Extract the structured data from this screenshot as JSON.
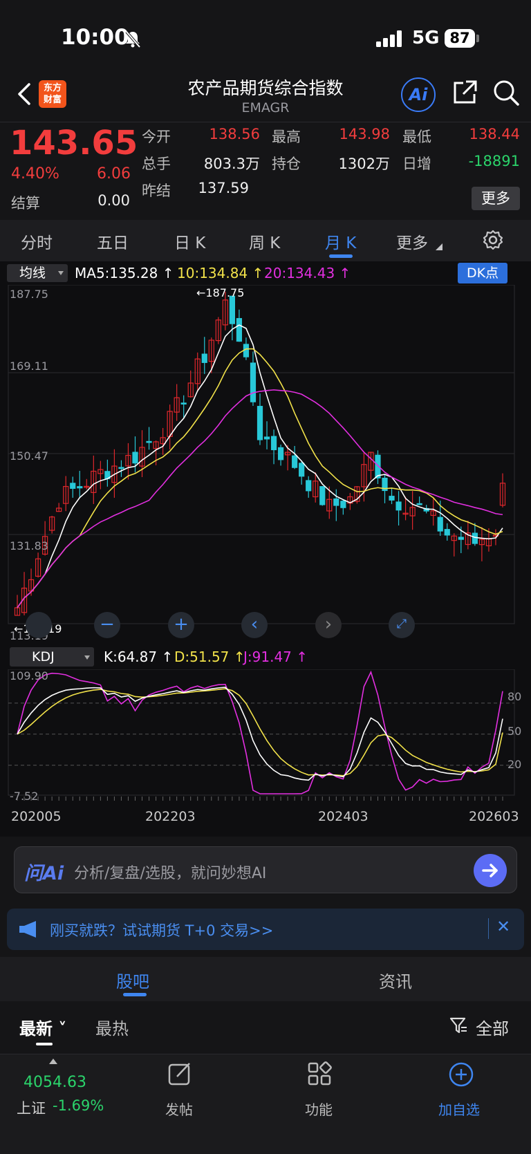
{
  "status": {
    "time": "10:00",
    "network": "5G",
    "battery": "87"
  },
  "header": {
    "logo_text": [
      "东方",
      "财富"
    ],
    "title": "农产品期货综合指数",
    "code": "EMAGR",
    "ai_label": "Ai"
  },
  "quote": {
    "price": "143.65",
    "pct": "4.40%",
    "change": "6.06",
    "settle_label": "结算",
    "settle": "0.00",
    "fields": [
      {
        "label": "今开",
        "value": "138.56",
        "color": "red"
      },
      {
        "label": "最高",
        "value": "143.98",
        "color": "red"
      },
      {
        "label": "最低",
        "value": "138.44",
        "color": "red"
      },
      {
        "label": "总手",
        "value": "803.3万",
        "color": "white"
      },
      {
        "label": "持仓",
        "value": "1302万",
        "color": "white"
      },
      {
        "label": "日增",
        "value": "-18891",
        "color": "green"
      },
      {
        "label": "昨结",
        "value": "137.59",
        "color": "white"
      }
    ],
    "more_label": "更多"
  },
  "tabs": [
    "分时",
    "五日",
    "日 K",
    "周 K",
    "月 K",
    "更多"
  ],
  "active_tab": "月 K",
  "chart": {
    "ma_selector": "均线",
    "ma5": "MA5:135.28",
    "ma10": "10:134.84",
    "ma20": "20:134.43",
    "dk_label": "DK点",
    "y_labels": [
      "187.75",
      "169.11",
      "150.47",
      "131.83",
      "113.19"
    ],
    "high_marker": "187.75",
    "low_marker": "113.19",
    "kdj_selector": "KDJ",
    "k": "K:64.87",
    "d": "D:51.57",
    "j": "J:91.47",
    "kdj_y_labels": [
      "109.90",
      "-7.52"
    ],
    "kdj_levels": [
      "80",
      "50",
      "20"
    ],
    "dates": [
      "202005",
      "202203",
      "202403",
      "202603"
    ],
    "colors": {
      "up": "#e0272c",
      "down": "#28c8d8",
      "ma5": "#ffffff",
      "ma10": "#f2e24a",
      "ma20": "#e22fe0"
    }
  },
  "chart_data": {
    "type": "candlestick",
    "period": "monthly",
    "x_range": [
      "202005",
      "202603"
    ],
    "ylim": [
      113.19,
      187.75
    ],
    "high": 187.75,
    "low": 113.19,
    "last": 143.65,
    "ma": {
      "MA5": 135.28,
      "MA10": 134.84,
      "MA20": 134.43
    },
    "kdj": {
      "K": 64.87,
      "D": 51.57,
      "J": 91.47,
      "ylim": [
        -7.52,
        109.9
      ],
      "levels": [
        80,
        50,
        20
      ]
    }
  },
  "ai_bar": {
    "logo": "问Ai",
    "placeholder": "分析/复盘/选股，就问妙想AI"
  },
  "promo": {
    "text": "刚买就跌？试试期货 T+0 交易>>"
  },
  "community": {
    "tabs": [
      "股吧",
      "资讯"
    ],
    "sort_new": "最新",
    "sort_hot": "最热",
    "filter": "全部"
  },
  "bottom": {
    "index_value": "4054.63",
    "index_name": "上证",
    "index_pct": "-1.69%",
    "post": "发帖",
    "func": "功能",
    "add": "加自选"
  }
}
